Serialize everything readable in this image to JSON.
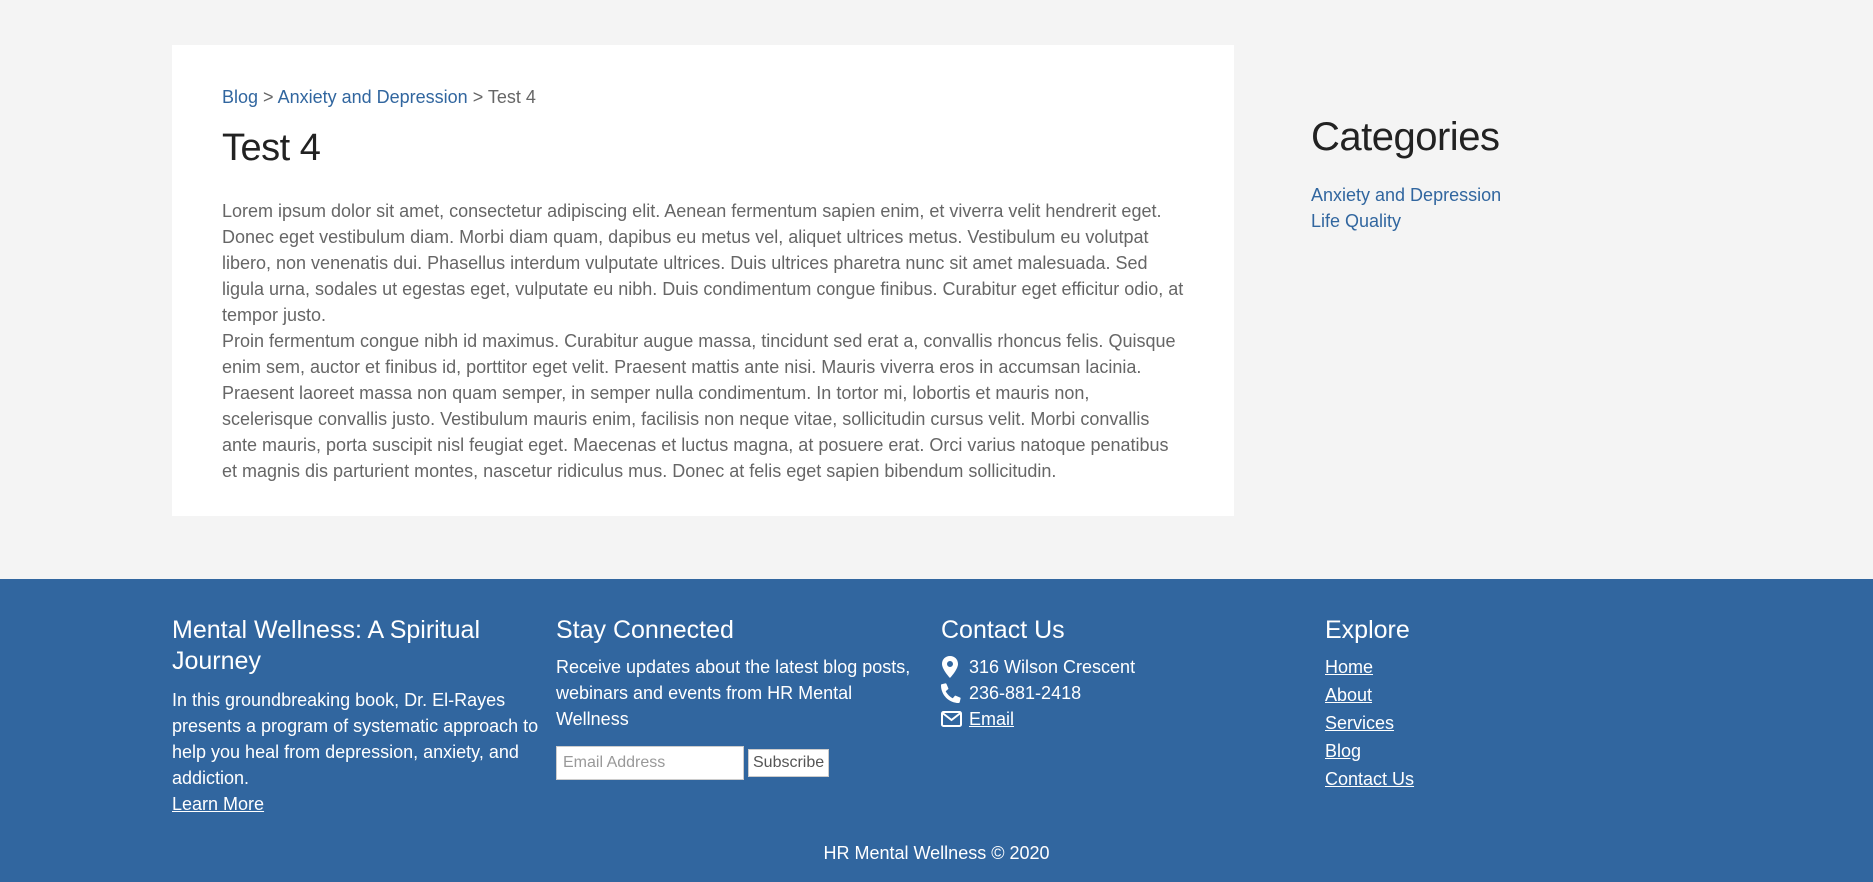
{
  "breadcrumb": {
    "items": [
      "Blog",
      "Anxiety and Depression"
    ],
    "separator": ">",
    "current": "Test 4"
  },
  "post": {
    "title": "Test 4",
    "paragraphs": [
      "Lorem ipsum dolor sit amet, consectetur adipiscing elit. Aenean fermentum sapien enim, et viverra velit hendrerit eget. Donec eget vestibulum diam. Morbi diam quam, dapibus eu metus vel, aliquet ultrices metus. Vestibulum eu volutpat libero, non venenatis dui. Phasellus interdum vulputate ultrices. Duis ultrices pharetra nunc sit amet malesuada. Sed ligula urna, sodales ut egestas eget, vulputate eu nibh. Duis condimentum congue finibus. Curabitur eget efficitur odio, at tempor justo.",
      "Proin fermentum congue nibh id maximus. Curabitur augue massa, tincidunt sed erat a, convallis rhoncus felis. Quisque enim sem, auctor et finibus id, porttitor eget velit. Praesent mattis ante nisi. Mauris viverra eros in accumsan lacinia. Praesent laoreet massa non quam semper, in semper nulla condimentum. In tortor mi, lobortis et mauris non, scelerisque convallis justo. Vestibulum mauris enim, facilisis non neque vitae, sollicitudin cursus velit. Morbi convallis ante mauris, porta suscipit nisl feugiat eget. Maecenas et luctus magna, at posuere erat. Orci varius natoque penatibus et magnis dis parturient montes, nascetur ridiculus mus. Donec at felis eget sapien bibendum sollicitudin."
    ]
  },
  "sidebar": {
    "title": "Categories",
    "categories": [
      "Anxiety and Depression",
      "Life Quality"
    ]
  },
  "footer": {
    "book": {
      "title": "Mental Wellness: A Spiritual Journey",
      "description": "In this groundbreaking book, Dr. El-Rayes presents a program of systematic approach to help you heal from depression, anxiety, and addiction.",
      "link": "Learn More"
    },
    "newsletter": {
      "title": "Stay Connected",
      "description": "Receive updates about the latest blog posts, webinars and events from HR Mental Wellness",
      "placeholder": "Email Address",
      "button": "Subscribe"
    },
    "contact": {
      "title": "Contact Us",
      "address": "316 Wilson Crescent",
      "phone": "236-881-2418",
      "email": "Email"
    },
    "explore": {
      "title": "Explore",
      "links": [
        "Home",
        "About",
        "Services",
        "Blog",
        "Contact Us"
      ]
    },
    "copyright": "HR Mental Wellness © 2020"
  },
  "colors": {
    "accent": "#31669f",
    "background": "#f4f4f4",
    "heading": "#222222",
    "body_text": "#666666"
  },
  "icons": [
    "map-marker-icon",
    "phone-icon",
    "envelope-icon"
  ]
}
